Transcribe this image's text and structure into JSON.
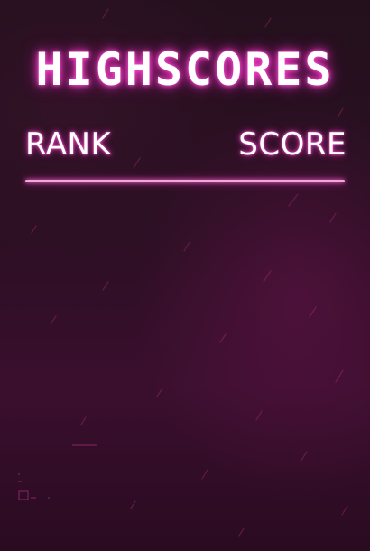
{
  "screen": {
    "title": "HIGHSCORES",
    "columns": {
      "rank": "RANK",
      "score": "SCORE"
    },
    "entries": []
  },
  "colors": {
    "glow": "#ff3cc8",
    "divider": "#f1a6dc",
    "background": "#2a0f22"
  }
}
